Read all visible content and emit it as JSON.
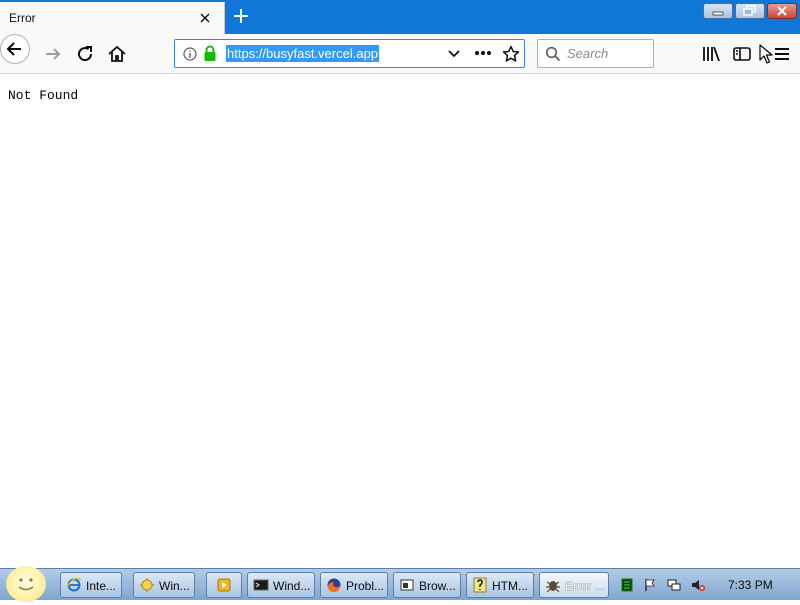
{
  "browser": {
    "tab_title": "Error",
    "url": "https://busyfast.vercel.app",
    "search_placeholder": "Search"
  },
  "page": {
    "body_text": "Not Found"
  },
  "taskbar": {
    "items": [
      {
        "label": "Inte...",
        "icon": "internet-explorer-icon"
      },
      {
        "label": "Win...",
        "icon": "folder-icon"
      },
      {
        "label": "",
        "icon": "media-player-icon"
      },
      {
        "label": "Wind...",
        "icon": "terminal-icon"
      },
      {
        "label": "Probl...",
        "icon": "firefox-icon"
      },
      {
        "label": "Brow...",
        "icon": "window-icon"
      },
      {
        "label": "HTM...",
        "icon": "help-file-icon"
      },
      {
        "label": "Error ...",
        "icon": "bug-icon"
      }
    ],
    "clock": "7:33 PM"
  },
  "colors": {
    "accent": "#0f77d8",
    "url_highlight": "#3399ff",
    "lock_green": "#12bc00"
  }
}
